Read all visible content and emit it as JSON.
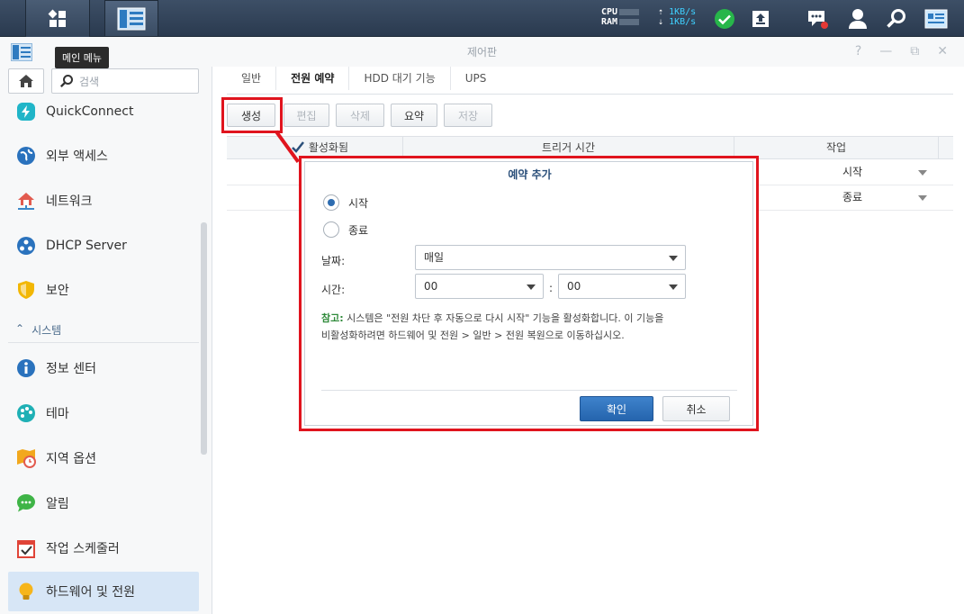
{
  "taskbar": {
    "cpu_label": "CPU",
    "ram_label": "RAM",
    "upload": "1KB/s",
    "download": "1KB/s",
    "colors": {
      "bg": "#2f4056",
      "accent": "#3fd0ff",
      "status_ok": "#27b64a",
      "notify": "#e53935"
    }
  },
  "window": {
    "title": "제어판",
    "tooltip": "메인 메뉴"
  },
  "sidebar": {
    "search_placeholder": "검색",
    "items": [
      {
        "label": "QuickConnect",
        "icon": "quickconnect-icon"
      },
      {
        "label": "외부 액세스",
        "icon": "globe-icon"
      },
      {
        "label": "네트워크",
        "icon": "house-network-icon"
      },
      {
        "label": "DHCP Server",
        "icon": "dhcp-icon"
      },
      {
        "label": "보안",
        "icon": "shield-icon"
      }
    ],
    "section_label": "시스템",
    "system_items": [
      {
        "label": "정보 센터",
        "icon": "info-icon"
      },
      {
        "label": "테마",
        "icon": "palette-icon"
      },
      {
        "label": "지역 옵션",
        "icon": "map-clock-icon"
      },
      {
        "label": "알림",
        "icon": "chat-bubble-icon"
      },
      {
        "label": "작업 스케줄러",
        "icon": "calendar-check-icon"
      },
      {
        "label": "하드웨어 및 전원",
        "icon": "lightbulb-icon"
      }
    ]
  },
  "tabs": [
    "일반",
    "전원 예약",
    "HDD 대기 기능",
    "UPS"
  ],
  "toolbar": {
    "create": "생성",
    "edit": "편집",
    "delete": "삭제",
    "summary": "요약",
    "save": "저장"
  },
  "grid": {
    "headers": {
      "enabled": "활성화됨",
      "trigger": "트리거 시간",
      "action": "작업"
    },
    "rows": [
      {
        "action": "시작"
      },
      {
        "action": "종료"
      }
    ]
  },
  "dialog": {
    "title": "예약 추가",
    "radio_start": "시작",
    "radio_stop": "종료",
    "date_label": "날짜:",
    "date_value": "매일",
    "time_label": "시간:",
    "hour_value": "00",
    "time_sep": ":",
    "minute_value": "00",
    "note_label": "참고:",
    "note_line1": "시스템은 \"전원 차단 후 자동으로 다시 시작\" 기능을 활성화합니다. 이 기능을",
    "note_line2": "비활성화하려면 하드웨어 및 전원 > 일반 > 전원 복원으로 이동하십시오.",
    "ok": "확인",
    "cancel": "취소"
  }
}
